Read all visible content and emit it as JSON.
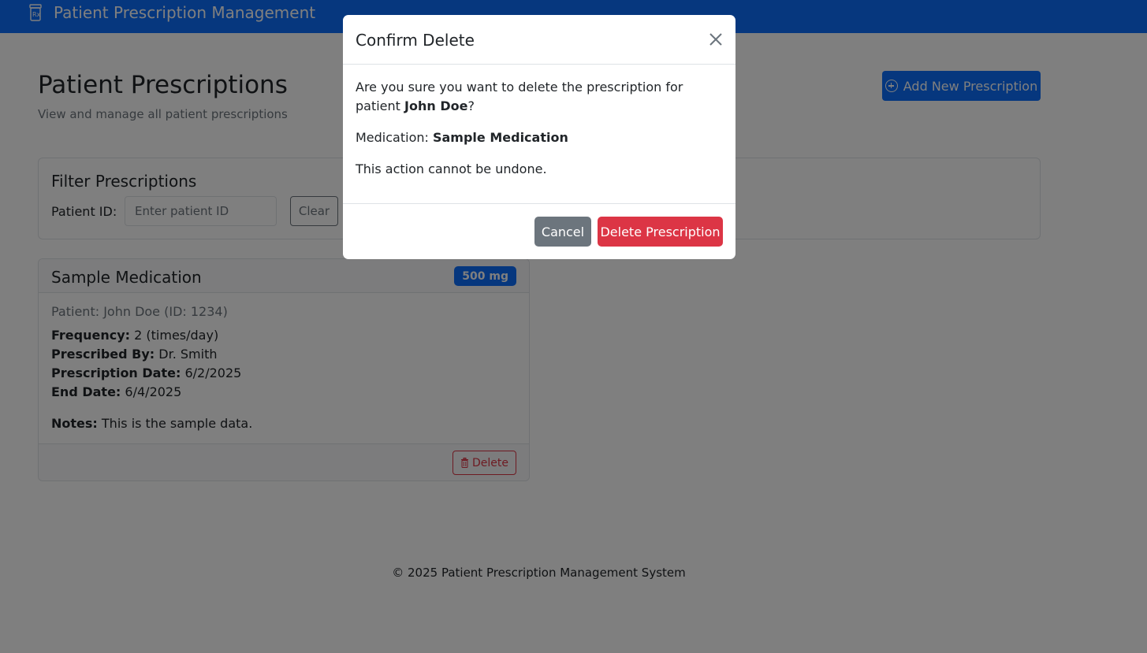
{
  "navbar": {
    "brand": "Patient Prescription Management",
    "icon": "prescription-bottle-icon"
  },
  "header": {
    "title": "Patient Prescriptions",
    "subtitle": "View and manage all patient prescriptions",
    "add_button_label": "Add New Prescription"
  },
  "filter": {
    "title": "Filter Prescriptions",
    "label": "Patient ID:",
    "placeholder": "Enter patient ID",
    "value": "",
    "clear_label": "Clear"
  },
  "prescription": {
    "medication": "Sample Medication",
    "dosage": "500 mg",
    "patient_line": "Patient: John Doe (ID: 1234)",
    "frequency_label": "Frequency:",
    "frequency_value": "2 (times/day)",
    "prescribed_by_label": "Prescribed By:",
    "prescribed_by_value": "Dr. Smith",
    "prescription_date_label": "Prescription Date:",
    "prescription_date_value": "6/2/2025",
    "end_date_label": "End Date:",
    "end_date_value": "6/4/2025",
    "notes_label": "Notes:",
    "notes_value": "This is the sample data.",
    "delete_label": "Delete"
  },
  "footer": {
    "text": "© 2025 Patient Prescription Management System"
  },
  "modal": {
    "title": "Confirm Delete",
    "question_prefix": "Are you sure you want to delete the prescription for patient ",
    "patient_name": "John Doe",
    "question_suffix": "?",
    "medication_label": "Medication: ",
    "medication_value": "Sample Medication",
    "warning": "This action cannot be undone.",
    "cancel_label": "Cancel",
    "confirm_label": "Delete Prescription"
  },
  "colors": {
    "primary": "#0d6efd",
    "danger": "#dc3545",
    "secondary": "#6c757d",
    "backdrop": "rgba(0,0,0,0.5)"
  }
}
